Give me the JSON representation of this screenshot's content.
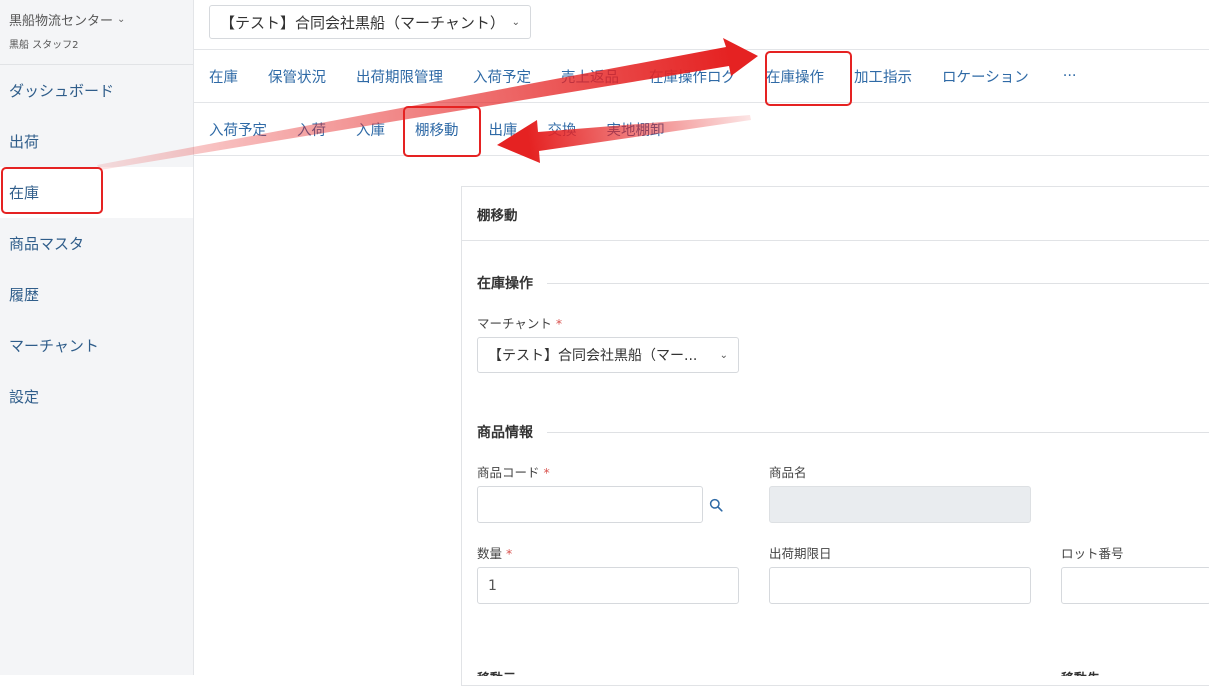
{
  "sidebar": {
    "org_name": "黒船物流センター",
    "user": "黒船 スタッフ2",
    "items": [
      {
        "label": "ダッシュボード"
      },
      {
        "label": "出荷"
      },
      {
        "label": "在庫"
      },
      {
        "label": "商品マスタ"
      },
      {
        "label": "履歴"
      },
      {
        "label": "マーチャント"
      },
      {
        "label": "設定"
      }
    ]
  },
  "header": {
    "merchant_select": "【テスト】合同会社黒船（マーチャント）"
  },
  "tabs_primary": [
    {
      "label": "在庫"
    },
    {
      "label": "保管状況"
    },
    {
      "label": "出荷期限管理"
    },
    {
      "label": "入荷予定"
    },
    {
      "label": "売上返品"
    },
    {
      "label": "在庫操作ログ"
    },
    {
      "label": "在庫操作"
    },
    {
      "label": "加工指示"
    },
    {
      "label": "ロケーション"
    },
    {
      "label": "···"
    }
  ],
  "tabs_secondary": [
    {
      "label": "入荷予定"
    },
    {
      "label": "入荷"
    },
    {
      "label": "入庫"
    },
    {
      "label": "棚移動"
    },
    {
      "label": "出庫"
    },
    {
      "label": "交換"
    },
    {
      "label": "実地棚卸"
    }
  ],
  "card": {
    "title": "棚移動",
    "section_stock": "在庫操作",
    "merchant_label": "マーチャント",
    "merchant_value": "【テスト】合同会社黒船（マー...",
    "section_product": "商品情報",
    "product_code_label": "商品コード",
    "product_code_value": "",
    "product_name_label": "商品名",
    "product_name_value": "",
    "quantity_label": "数量",
    "quantity_value": "1",
    "expiry_label": "出荷期限日",
    "expiry_value": "",
    "lot_label": "ロット番号",
    "lot_value": "",
    "from_label": "移動元",
    "to_label": "移動先",
    "required_mark": "*"
  },
  "colors": {
    "accent": "#2f6aa6",
    "highlight": "#e52222",
    "required": "#d9534f"
  }
}
